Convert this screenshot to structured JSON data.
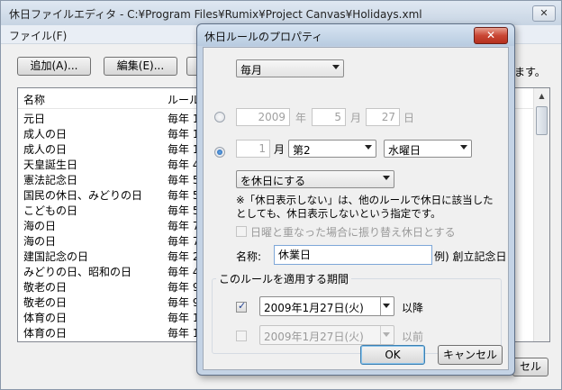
{
  "main": {
    "title": "休日ファイルエディタ - C:¥Program Files¥Rumix¥Project Canvas¥Holidays.xml",
    "close_glyph": "✕",
    "menu": {
      "file": "ファイル(F)"
    },
    "buttons": {
      "add": "追加(A)...",
      "edit": "編集(E)...",
      "cancel": "セル"
    },
    "hint_tail": "ます。",
    "list": {
      "columns": [
        "名称",
        "ルール"
      ],
      "rows": [
        [
          "元日",
          "毎年 1"
        ],
        [
          "成人の日",
          "毎年 1"
        ],
        [
          "成人の日",
          "毎年 1"
        ],
        [
          "天皇誕生日",
          "毎年 4"
        ],
        [
          "憲法記念日",
          "毎年 5"
        ],
        [
          "国民の休日、みどりの日",
          "毎年 5"
        ],
        [
          "こどもの日",
          "毎年 5"
        ],
        [
          "海の日",
          "毎年 7"
        ],
        [
          "海の日",
          "毎年 7"
        ],
        [
          "建国記念の日",
          "毎年 2"
        ],
        [
          "みどりの日、昭和の日",
          "毎年 4"
        ],
        [
          "敬老の日",
          "毎年 9"
        ],
        [
          "敬老の日",
          "毎年 9"
        ],
        [
          "体育の日",
          "毎年 1"
        ],
        [
          "体育の日",
          "毎年 1"
        ]
      ]
    }
  },
  "dialog": {
    "title": "休日ルールのプロパティ",
    "close_glyph": "✕",
    "frequency": "毎月",
    "fixed_date": {
      "year": "2009",
      "year_unit": "年",
      "month": "5",
      "month_unit": "月",
      "day": "27",
      "day_unit": "日"
    },
    "weekday_rule": {
      "month": "1",
      "month_unit": "月",
      "week": "第2",
      "weekday": "水曜日"
    },
    "action": "を休日にする",
    "note": "※「休日表示しない」は、他のルールで休日に該当したとしても、休日表示しないという指定です。",
    "substitute_label": "日曜と重なった場合に振り替え休日とする",
    "name_label": "名称:",
    "name_value": "休業日",
    "name_example": "例) 創立記念日",
    "period": {
      "legend": "このルールを適用する期間",
      "from_date": "2009年1月27日(火)",
      "from_label": "以降",
      "to_date": "2009年1月27日(火)",
      "to_label": "以前"
    },
    "ok": "OK",
    "cancel": "キャンセル"
  }
}
